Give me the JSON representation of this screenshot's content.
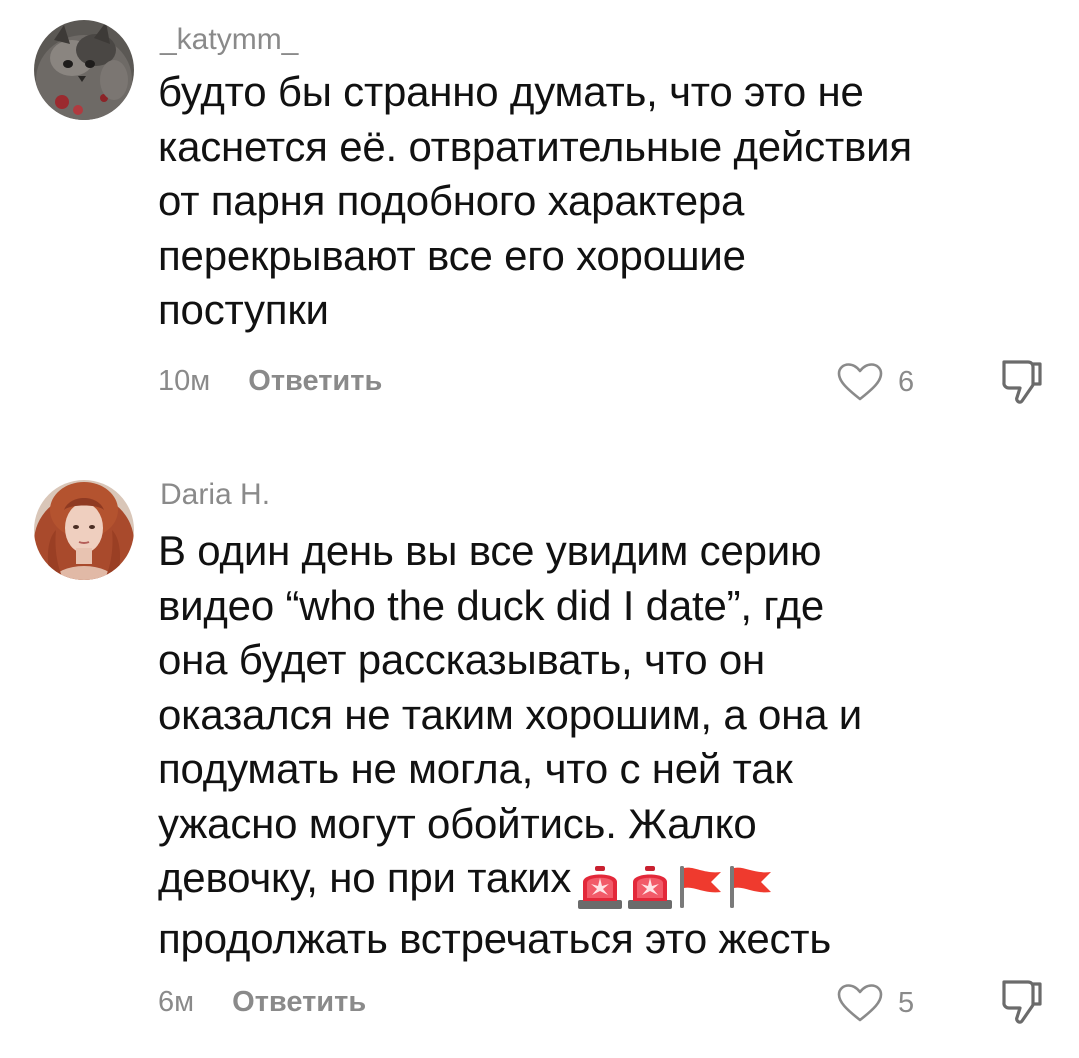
{
  "comments": [
    {
      "username": "_katymm_",
      "text_lines": [
        "будто бы странно думать, что это не",
        "каснется её. отвратительные действия",
        "от парня подобного характера",
        "перекрывают все его хорошие",
        "поступки"
      ],
      "time": "10м",
      "reply_label": "Ответить",
      "likes": "6",
      "avatar_icon": "cat-avatar"
    },
    {
      "username": "Daria H.",
      "text_lines": [
        "В один день вы все увидим серию",
        "видео “who the duck did I date”, где",
        "она будет рассказывать, что он",
        "оказался не таким хорошим, а она и",
        "подумать не могла, что с ней так",
        "ужасно могут обойтись. Жалко",
        "девочку, но при таких",
        "продолжать встречаться это жесть"
      ],
      "time": "6м",
      "reply_label": "Ответить",
      "likes": "5",
      "avatar_icon": "redhead-woman-avatar",
      "emojis": [
        "police-light-emoji",
        "police-light-emoji",
        "red-flag-emoji",
        "red-flag-emoji"
      ]
    }
  ],
  "colors": {
    "text": "#111111",
    "secondary": "#8a8a8a",
    "background": "#ffffff"
  }
}
